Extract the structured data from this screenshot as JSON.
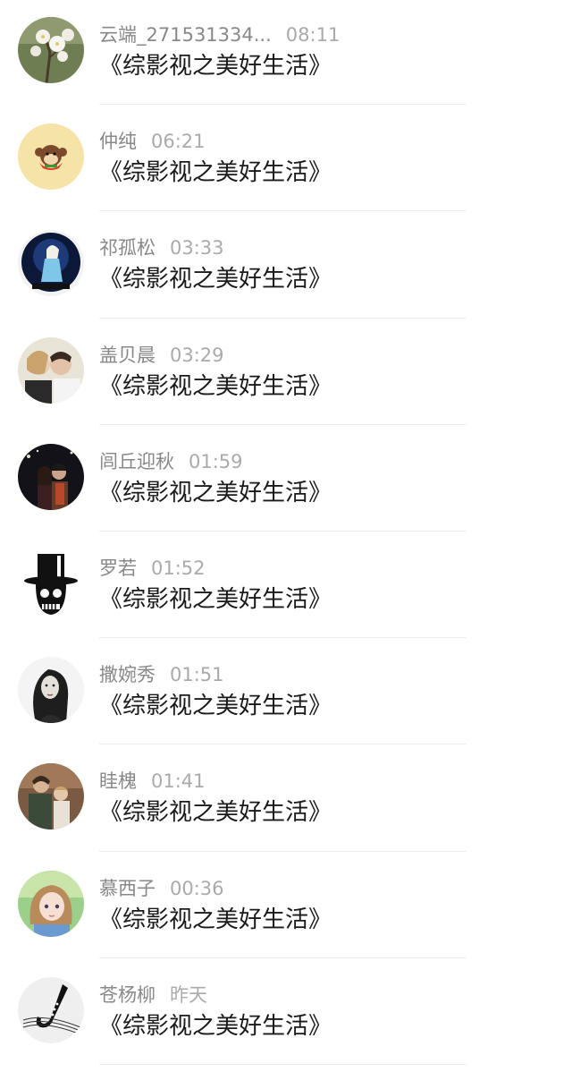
{
  "comments": [
    {
      "name": "云端_271531334...",
      "time": "08:11",
      "text": "《综影视之美好生活》",
      "avatar": "cherry-blossom-icon"
    },
    {
      "name": "仲纯",
      "time": "06:21",
      "text": "《综影视之美好生活》",
      "avatar": "monkey-icon"
    },
    {
      "name": "祁孤松",
      "time": "03:33",
      "text": "《综影视之美好生活》",
      "avatar": "princess-icon"
    },
    {
      "name": "盖贝晨",
      "time": "03:29",
      "text": "《综影视之美好生活》",
      "avatar": "couple-icon"
    },
    {
      "name": "闾丘迎秋",
      "time": "01:59",
      "text": "《综影视之美好生活》",
      "avatar": "night-couple-icon"
    },
    {
      "name": "罗若",
      "time": "01:52",
      "text": "《综影视之美好生活》",
      "avatar": "skull-tophat-icon"
    },
    {
      "name": "撒婉秀",
      "time": "01:51",
      "text": "《综影视之美好生活》",
      "avatar": "girl-portrait-icon"
    },
    {
      "name": "眭槐",
      "time": "01:41",
      "text": "《综影视之美好生活》",
      "avatar": "family-icon"
    },
    {
      "name": "慕西子",
      "time": "00:36",
      "text": "《综影视之美好生活》",
      "avatar": "anime-girl-icon"
    },
    {
      "name": "苍杨柳",
      "time": "昨天",
      "text": "《综影视之美好生活》",
      "avatar": "saxophone-icon"
    }
  ],
  "colors": {
    "name": "#888888",
    "time": "#aaaaaa",
    "text": "#1a1a1a",
    "divider": "#ededed"
  }
}
